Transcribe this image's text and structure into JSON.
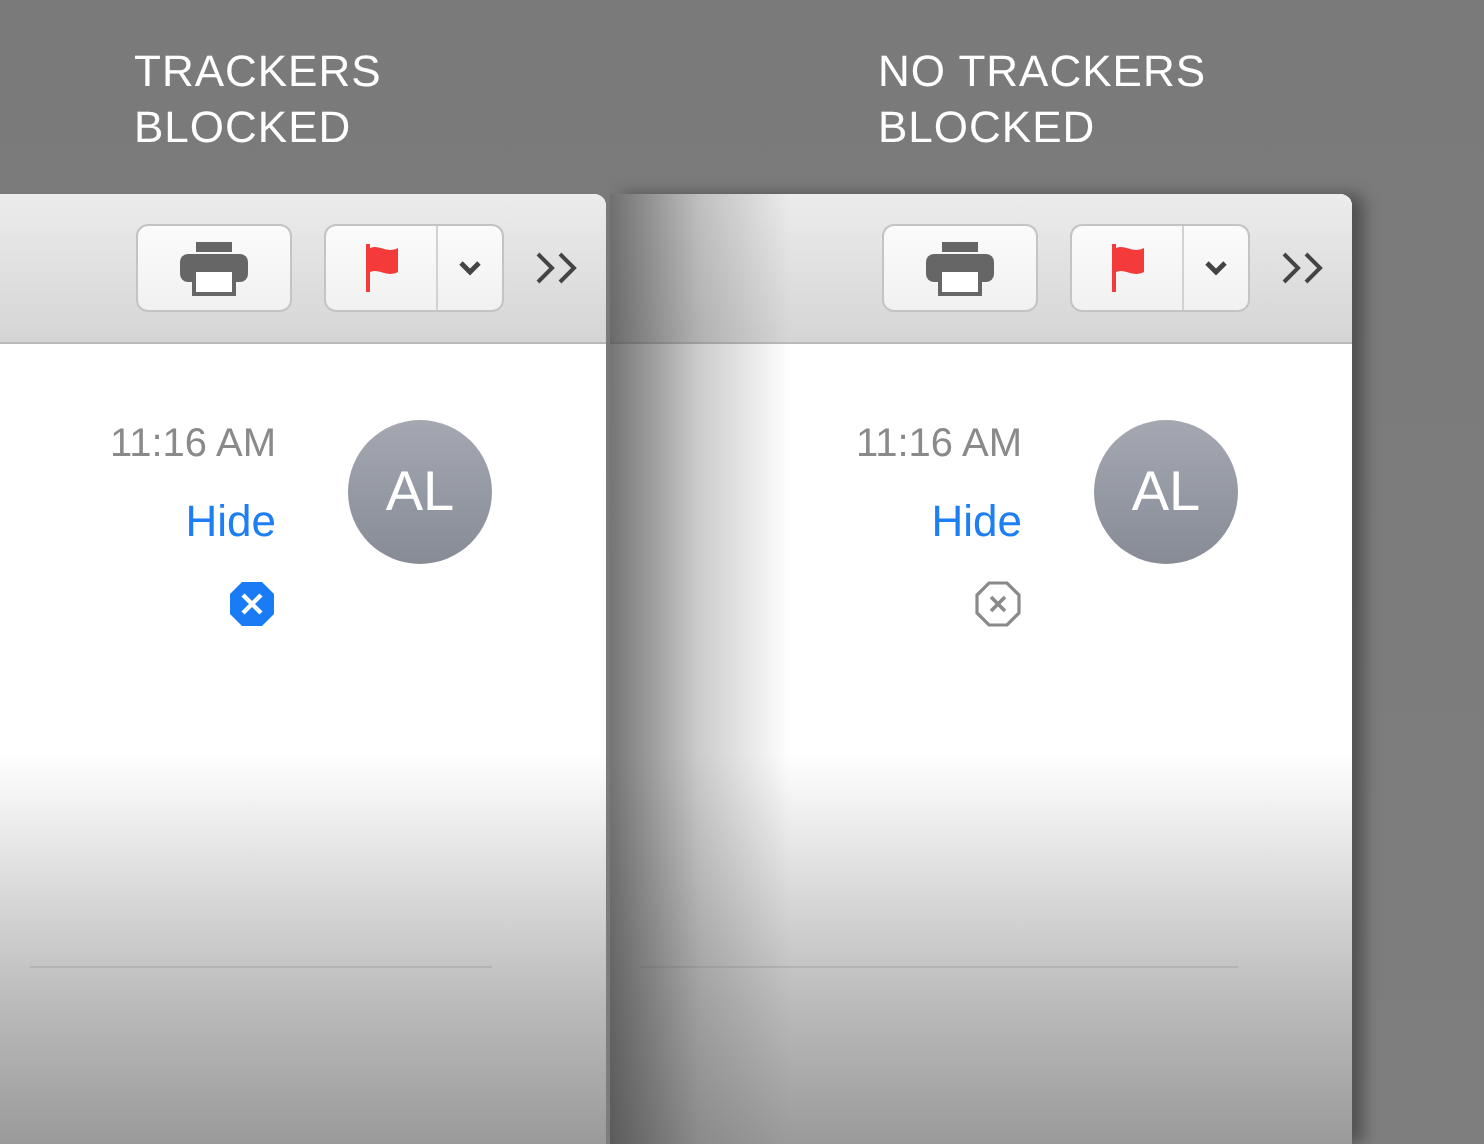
{
  "panels": [
    {
      "caption": "TRACKERS\nBLOCKED",
      "time": "11:16 AM",
      "hide_link": "Hide",
      "avatar": "AL",
      "trackers_blocked": true,
      "shadowed": false
    },
    {
      "caption": "NO TRACKERS\nBLOCKED",
      "time": "11:16 AM",
      "hide_link": "Hide",
      "avatar": "AL",
      "trackers_blocked": false,
      "shadowed": true
    }
  ]
}
